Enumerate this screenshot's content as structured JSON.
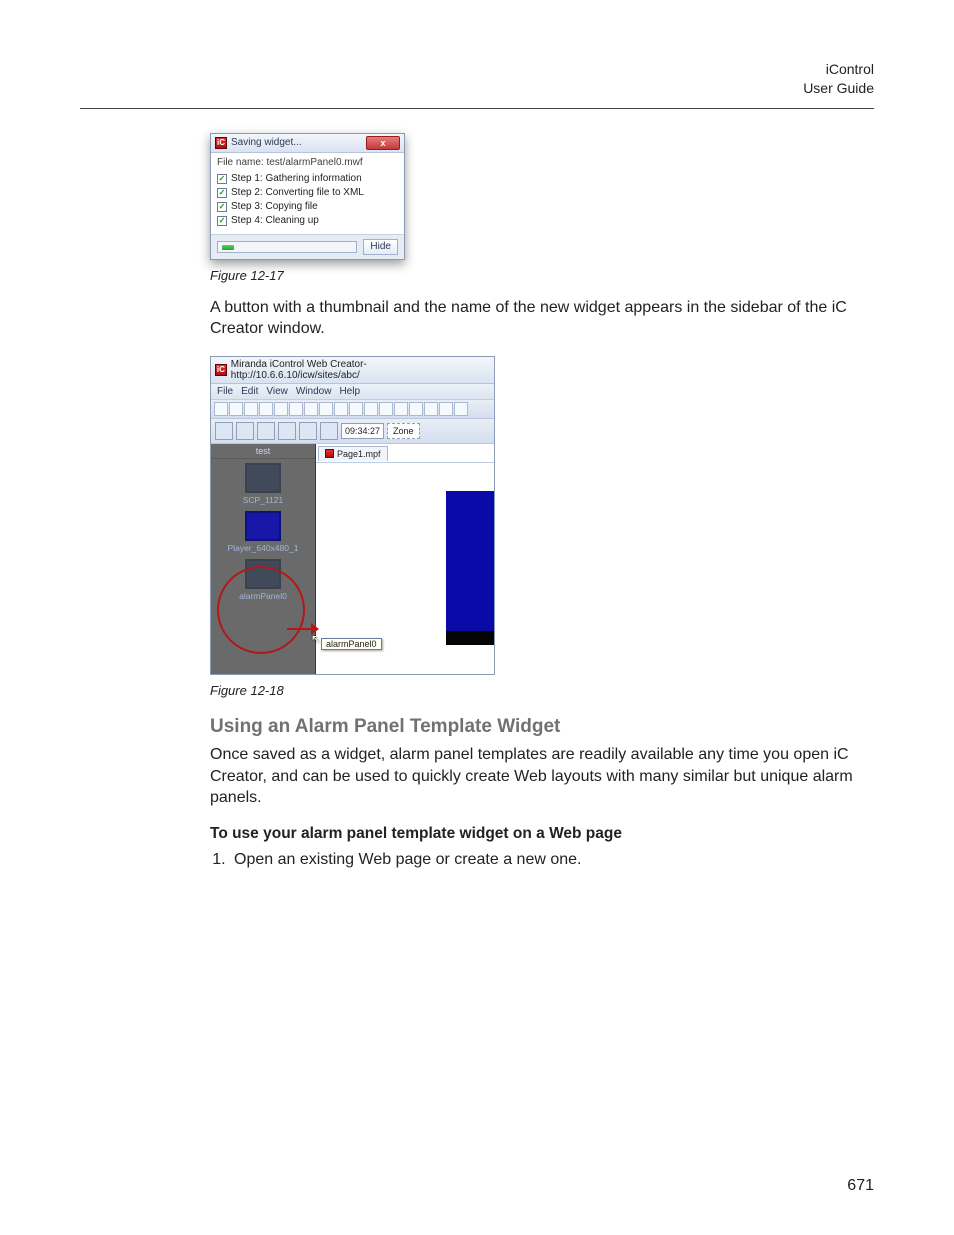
{
  "header": {
    "title": "iControl",
    "subtitle": "User Guide"
  },
  "figure1": {
    "dialogTitle": "Saving widget...",
    "closeLabel": "x",
    "fileNameLine": "File name: test/alarmPanel0.mwf",
    "steps": {
      "s1": "Step 1: Gathering information",
      "s2": "Step 2: Converting file to XML",
      "s3": "Step 3: Copying file",
      "s4": "Step 4: Cleaning up"
    },
    "hideLabel": "Hide",
    "caption": "Figure 12-17"
  },
  "para1": "A button with a thumbnail and the name of the new widget appears in the sidebar of the iC Creator window.",
  "figure2": {
    "windowTitle": "Miranda iControl Web Creator-http://10.6.6.10/icw/sites/abc/",
    "menus": {
      "file": "File",
      "edit": "Edit",
      "view": "View",
      "window": "Window",
      "help": "Help"
    },
    "time": "09:34:27",
    "zone": "Zone",
    "sidebarTitle": "test",
    "items": {
      "i1": "SCP_1121",
      "i2": "Player_640x480_1",
      "i3": "alarmPanel0"
    },
    "tabLabel": "Page1.mpf",
    "tooltip": "alarmPanel0",
    "caption": "Figure 12-18"
  },
  "sectionTitle": "Using an Alarm Panel Template Widget",
  "para2": "Once saved as a widget, alarm panel templates are readily available any time you open iC Creator, and can be used to quickly create Web layouts with many similar but unique alarm panels.",
  "subheading": "To use your alarm panel template widget on a Web page",
  "step1": "Open an existing Web page or create a new one.",
  "pageNumber": "671"
}
